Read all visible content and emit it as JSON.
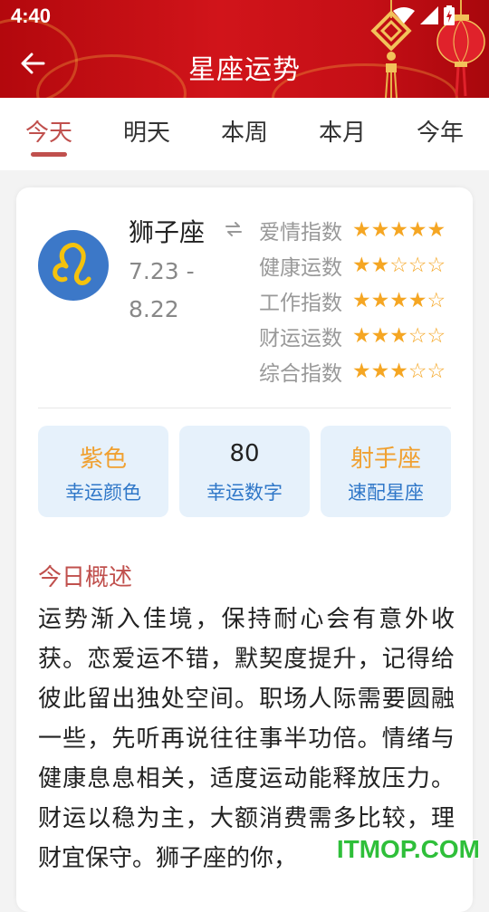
{
  "status_bar": {
    "time": "4:40"
  },
  "header": {
    "title": "星座运势"
  },
  "tabs": [
    {
      "label": "今天",
      "active": true
    },
    {
      "label": "明天",
      "active": false
    },
    {
      "label": "本周",
      "active": false
    },
    {
      "label": "本月",
      "active": false
    },
    {
      "label": "今年",
      "active": false
    }
  ],
  "sign": {
    "name": "狮子座",
    "dates": "7.23 - 8.22",
    "icon": "leo-icon"
  },
  "ratings": [
    {
      "label": "爱情指数",
      "stars": "★★★★★",
      "value": 5
    },
    {
      "label": "健康运数",
      "stars": "★★☆☆☆",
      "value": 2
    },
    {
      "label": "工作指数",
      "stars": "★★★★☆",
      "value": 4
    },
    {
      "label": "财运运数",
      "stars": "★★★☆☆",
      "value": 3
    },
    {
      "label": "综合指数",
      "stars": "★★★☆☆",
      "value": 3
    }
  ],
  "lucky": {
    "color": {
      "value": "紫色",
      "label": "幸运颜色"
    },
    "number": {
      "value": "80",
      "label": "幸运数字"
    },
    "match": {
      "value": "射手座",
      "label": "速配星座"
    }
  },
  "summary": {
    "title": "今日概述",
    "text": "运势渐入佳境，保持耐心会有意外收获。恋爱运不错，默契度提升，记得给彼此留出独处空间。职场人际需要圆融一些，先听再说往往事半功倍。情绪与健康息息相关，适度运动能释放压力。财运以稳为主，大额消费需多比较，理财宜保守。狮子座的你，"
  },
  "watermark": "ITMOP.COM",
  "colors": {
    "header": "#c8111a",
    "accent": "#c0504d",
    "star": "#f5a623",
    "box_bg": "#e6f1fb",
    "box_label": "#2f77c8"
  }
}
